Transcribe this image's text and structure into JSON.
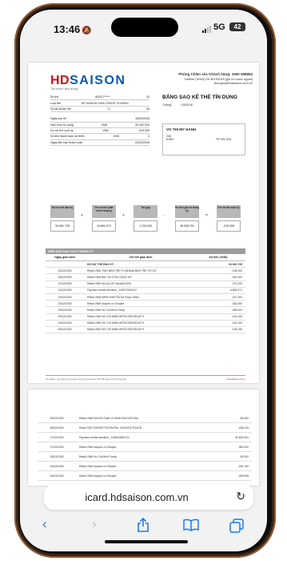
{
  "status": {
    "time": "13:46",
    "network": "5G",
    "battery": "42"
  },
  "header": {
    "brand_hd": "HD",
    "brand_saison": "SAISON",
    "tagline": "Tài chính tiêu dùng",
    "contact_line1": "Phòng Chăm sóc Khách hàng: 1900 558854",
    "contact_line2": "Hotline (VINA) 08 39151103 (gọi từ nước ngoài)",
    "contact_line3": "thongtin@hdsaison.com.vn",
    "statement_title": "BẢNG SAO KÊ THẺ TÍN DỤNG",
    "statement_date_label": "Tháng",
    "statement_date": "03/2026"
  },
  "account_info": [
    {
      "label": "Số thẻ",
      "mid": "400377*****",
      "value": "20"
    },
    {
      "label": "Loại thẻ",
      "mid": "HD SAISON VISA CREDIT CLASSIC",
      "value": ""
    },
    {
      "label": "Số tài khoản thẻ",
      "mid": "71",
      "value": "28"
    },
    {
      "label": "Ngày sao kê",
      "mid": "",
      "value": "18/03/2026"
    },
    {
      "label": "Hạn mức tín dụng",
      "mid": "VND",
      "value": "30.000.000"
    },
    {
      "label": "Dư nợ thẻ cuối kỳ",
      "mid": "VND",
      "value": "-319.399"
    },
    {
      "label": "Số tiền thanh toán tối thiểu",
      "mid": "VND",
      "value": "0"
    },
    {
      "label": "Ngày đến hạn thanh toán",
      "mid": "",
      "value": "02/04/2026"
    }
  ],
  "customer": {
    "name": "VO THI MY HANH",
    "line1": "240",
    "line2": "KINH",
    "city": "TP HO CHI"
  },
  "summary": [
    {
      "label": "Dư nợ thẻ đầu kỳ",
      "value": "33.081.728"
    },
    {
      "label": "Dư nợ thẻ phát sinh trong kỳ",
      "value": "16.894.072"
    },
    {
      "label": "Trả góp",
      "value": "1.233.000"
    },
    {
      "label": "Số tiền ghi có trong kỳ",
      "value": "45.328.791"
    },
    {
      "label": "Dư nợ thẻ cuối kỳ",
      "value": "-319.399"
    }
  ],
  "summary_ops": [
    "+",
    "+",
    "-",
    "="
  ],
  "transactions": {
    "title": "DIỄN GIẢI GIAO DỊCH TRONG KỲ",
    "col_date": "Ngày giao dịch",
    "col_desc": "Chi tiết giao dịch",
    "col_amount": "Số tiền (VND)",
    "rows": [
      {
        "date": "",
        "desc": "DƯ NỢ THẺ ĐẦU KỲ",
        "amount": "33.081.728"
      },
      {
        "date": "15/02/2026",
        "desc": "Retail VNM TINH BEN TRE PL BENAB BEN TRE TGT 67",
        "amount": "-198.000"
      },
      {
        "date": "15/02/2026",
        "desc": "Retail VNM Ben Tre CON CUNG 157",
        "amount": "-320.000"
      },
      {
        "date": "21/02/2026",
        "desc": "Retail VNM Ha Noi GP SaintMi 0094",
        "amount": "-372.000"
      },
      {
        "date": "21/02/2026",
        "desc": "Payment credit narrative_ 11697/2510/12",
        "amount": "6.869.271"
      },
      {
        "date": "22/02/2026",
        "desc": "Retail VNM MHW WHV*TikTok Shop Seller",
        "amount": "-227.000"
      },
      {
        "date": "22/02/2026",
        "desc": "Retail VNM shopee.vn Shopee",
        "amount": "-362.000"
      },
      {
        "date": "23/02/2026",
        "desc": "Retail VNM Ho Chi Minh Foody",
        "amount": "-355.000"
      },
      {
        "date": "23/02/2026",
        "desc": "Retail VNM HO CHI MINH MPGS BEGROUP 9",
        "amount": "-143.100"
      },
      {
        "date": "24/02/2026",
        "desc": "Retail VNM HO CHI MINH MPGS BEGROUP 9",
        "amount": "-143.100"
      },
      {
        "date": "25/02/2026",
        "desc": "Retail VNM HO CHI MINH MPGS BEGROUP 9",
        "amount": "-138.150"
      }
    ],
    "footer_note": "Trải nghiệm: Quý khách vui lòng kiểm tra kỹ nội dung sao kê. Mọi thắc mắc xin liên hệ tổng đài.",
    "footer_web": "www.hdsaison.com.vn"
  },
  "transactions_page2": [
    {
      "date": "25/02/2026",
      "desc": "Retail VNM HA NOI Grab* A-9008VTMVXNTUAV",
      "amount": "-60.000"
    },
    {
      "date": "25/02/2026",
      "desc": "Retail SGP 4029357733 PAYPAL *HOAYEUTHUON",
      "amount": "-408.319"
    },
    {
      "date": "27/02/2026",
      "desc": "Payment credit narrative_ 11650/0600721",
      "amount": "32.800.051"
    },
    {
      "date": "27/02/2026",
      "desc": "Retail VNM shopee.vn Shopee",
      "amount": "-380.000"
    },
    {
      "date": "03/03/2026",
      "desc": "Retail VNM Ho Chi Minh Foody",
      "amount": "-90.000"
    },
    {
      "date": "03/03/2026",
      "desc": "Retail VNM shopee.vn Shopee",
      "amount": "-291.760"
    },
    {
      "date": "03/03/2026",
      "desc": "Retail VNM shopee.vn Shopee",
      "amount": "-353.999"
    }
  ],
  "browser": {
    "url": "icard.hdsaison.com.vn"
  },
  "icons": [
    "reload-icon",
    "back-icon",
    "forward-icon",
    "share-icon",
    "bookmarks-icon",
    "tabs-icon"
  ]
}
